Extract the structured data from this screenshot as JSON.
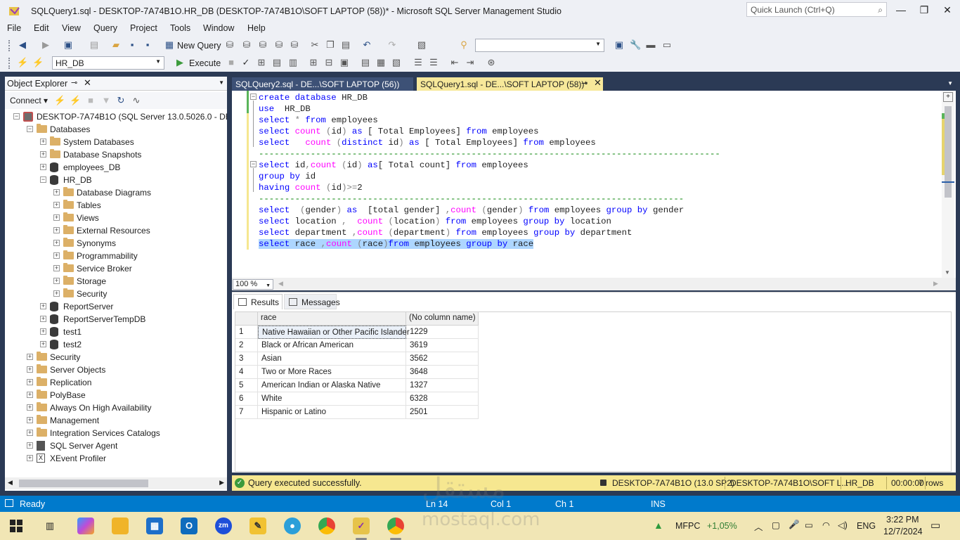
{
  "window": {
    "title": "SQLQuery1.sql - DESKTOP-7A74B1O.HR_DB (DESKTOP-7A74B1O\\SOFT LAPTOP (58))* - Microsoft SQL Server Management Studio",
    "quick_launch_placeholder": "Quick Launch (Ctrl+Q)",
    "min": "—",
    "max": "❐",
    "close": "✕"
  },
  "menu": [
    "File",
    "Edit",
    "View",
    "Query",
    "Project",
    "Tools",
    "Window",
    "Help"
  ],
  "toolbar1": {
    "new_query": "New Query"
  },
  "toolbar2": {
    "database": "HR_DB",
    "execute": "Execute"
  },
  "object_explorer": {
    "title": "Object Explorer",
    "pin": "⊸",
    "close": "✕",
    "connect": "Connect ▾",
    "tree": [
      {
        "label": "DESKTOP-7A74B1O (SQL Server 13.0.5026.0 - DESKT",
        "level": 0,
        "icon": "server",
        "exp": "−"
      },
      {
        "label": "Databases",
        "level": 1,
        "icon": "folder",
        "exp": "−"
      },
      {
        "label": "System Databases",
        "level": 2,
        "icon": "folder",
        "exp": "+"
      },
      {
        "label": "Database Snapshots",
        "level": 2,
        "icon": "folder",
        "exp": "+"
      },
      {
        "label": "employees_DB",
        "level": 2,
        "icon": "db",
        "exp": "+"
      },
      {
        "label": "HR_DB",
        "level": 2,
        "icon": "db",
        "exp": "−"
      },
      {
        "label": "Database Diagrams",
        "level": 3,
        "icon": "folder",
        "exp": "+"
      },
      {
        "label": "Tables",
        "level": 3,
        "icon": "folder",
        "exp": "+"
      },
      {
        "label": "Views",
        "level": 3,
        "icon": "folder",
        "exp": "+"
      },
      {
        "label": "External Resources",
        "level": 3,
        "icon": "folder",
        "exp": "+"
      },
      {
        "label": "Synonyms",
        "level": 3,
        "icon": "folder",
        "exp": "+"
      },
      {
        "label": "Programmability",
        "level": 3,
        "icon": "folder",
        "exp": "+"
      },
      {
        "label": "Service Broker",
        "level": 3,
        "icon": "folder",
        "exp": "+"
      },
      {
        "label": "Storage",
        "level": 3,
        "icon": "folder",
        "exp": "+"
      },
      {
        "label": "Security",
        "level": 3,
        "icon": "folder",
        "exp": "+"
      },
      {
        "label": "ReportServer",
        "level": 2,
        "icon": "db",
        "exp": "+"
      },
      {
        "label": "ReportServerTempDB",
        "level": 2,
        "icon": "db",
        "exp": "+"
      },
      {
        "label": "test1",
        "level": 2,
        "icon": "db",
        "exp": "+"
      },
      {
        "label": "test2",
        "level": 2,
        "icon": "db",
        "exp": "+"
      },
      {
        "label": "Security",
        "level": 1,
        "icon": "folder",
        "exp": "+"
      },
      {
        "label": "Server Objects",
        "level": 1,
        "icon": "folder",
        "exp": "+"
      },
      {
        "label": "Replication",
        "level": 1,
        "icon": "folder",
        "exp": "+"
      },
      {
        "label": "PolyBase",
        "level": 1,
        "icon": "folder",
        "exp": "+"
      },
      {
        "label": "Always On High Availability",
        "level": 1,
        "icon": "folder",
        "exp": "+"
      },
      {
        "label": "Management",
        "level": 1,
        "icon": "folder",
        "exp": "+"
      },
      {
        "label": "Integration Services Catalogs",
        "level": 1,
        "icon": "folder",
        "exp": "+"
      },
      {
        "label": "SQL Server Agent",
        "level": 1,
        "icon": "agent",
        "exp": "+"
      },
      {
        "label": "XEvent Profiler",
        "level": 1,
        "icon": "xe",
        "exp": "+"
      }
    ]
  },
  "tabs": {
    "inactive": "SQLQuery2.sql - DE...\\SOFT LAPTOP (56))",
    "active": "SQLQuery1.sql - DE...\\SOFT LAPTOP (58))*",
    "active_pin": "⊸",
    "active_close": "✕"
  },
  "code": [
    [
      [
        "kw",
        "create database "
      ],
      [
        "",
        "HR_DB"
      ]
    ],
    [
      [
        "kw",
        "use  "
      ],
      [
        "",
        "HR_DB"
      ]
    ],
    [
      [
        "kw",
        "select "
      ],
      [
        "gr",
        "* "
      ],
      [
        "kw",
        "from "
      ],
      [
        "",
        "employees"
      ]
    ],
    [
      [
        "kw",
        "select "
      ],
      [
        "fn",
        "count "
      ],
      [
        "gr",
        "("
      ],
      [
        "",
        "id"
      ],
      [
        "gr",
        ") "
      ],
      [
        "kw",
        "as "
      ],
      [
        "",
        "[ Total Employees] "
      ],
      [
        "kw",
        "from "
      ],
      [
        "",
        "employees"
      ]
    ],
    [
      [
        "kw",
        "select   "
      ],
      [
        "fn",
        "count "
      ],
      [
        "gr",
        "("
      ],
      [
        "kw",
        "distinct "
      ],
      [
        "",
        "id"
      ],
      [
        "gr",
        ") "
      ],
      [
        "kw",
        "as "
      ],
      [
        "",
        "[ Total Employees] "
      ],
      [
        "kw",
        "from "
      ],
      [
        "",
        "employees"
      ]
    ],
    [
      [
        "cm",
        "-----------------------------------------------------------------------------------------"
      ]
    ],
    [
      [
        "kw",
        "select "
      ],
      [
        "",
        "id"
      ],
      [
        "gr",
        ","
      ],
      [
        "fn",
        "count "
      ],
      [
        "gr",
        "("
      ],
      [
        "",
        "id"
      ],
      [
        "gr",
        ") "
      ],
      [
        "kw",
        "as"
      ],
      [
        "",
        "[ Total count] "
      ],
      [
        "kw",
        "from "
      ],
      [
        "",
        "employees"
      ]
    ],
    [
      [
        "kw",
        "group by "
      ],
      [
        "",
        "id"
      ]
    ],
    [
      [
        "kw",
        "having "
      ],
      [
        "fn",
        "count "
      ],
      [
        "gr",
        "("
      ],
      [
        "",
        "id"
      ],
      [
        "gr",
        ")>="
      ],
      [
        "",
        "2"
      ]
    ],
    [
      [
        "cm",
        "----------------------------------------------------------------------------------"
      ]
    ],
    [
      [
        "kw",
        "select  "
      ],
      [
        "gr",
        "("
      ],
      [
        "",
        "gender"
      ],
      [
        "gr",
        ") "
      ],
      [
        "kw",
        "as  "
      ],
      [
        "",
        "[total gender] "
      ],
      [
        "gr",
        ","
      ],
      [
        "fn",
        "count "
      ],
      [
        "gr",
        "("
      ],
      [
        "",
        "gender"
      ],
      [
        "gr",
        ") "
      ],
      [
        "kw",
        "from "
      ],
      [
        "",
        "employees "
      ],
      [
        "kw",
        "group by "
      ],
      [
        "",
        "gender"
      ]
    ],
    [
      [
        "kw",
        "select "
      ],
      [
        "",
        "location "
      ],
      [
        "gr",
        ",  "
      ],
      [
        "fn",
        "count "
      ],
      [
        "gr",
        "("
      ],
      [
        "",
        "location"
      ],
      [
        "gr",
        ") "
      ],
      [
        "kw",
        "from "
      ],
      [
        "",
        "employees "
      ],
      [
        "kw",
        "group by "
      ],
      [
        "",
        "location"
      ]
    ],
    [
      [
        "kw",
        "select "
      ],
      [
        "",
        "department "
      ],
      [
        "gr",
        ","
      ],
      [
        "fn",
        "count "
      ],
      [
        "gr",
        "("
      ],
      [
        "",
        "department"
      ],
      [
        "gr",
        ") "
      ],
      [
        "kw",
        "from "
      ],
      [
        "",
        "employees "
      ],
      [
        "kw",
        "group by "
      ],
      [
        "",
        "department"
      ]
    ],
    [
      [
        "kw",
        "select "
      ],
      [
        "",
        "race "
      ],
      [
        "gr",
        ","
      ],
      [
        "fn",
        "count "
      ],
      [
        "gr",
        "("
      ],
      [
        "",
        "race"
      ],
      [
        "gr",
        ")"
      ],
      [
        "kw",
        "from "
      ],
      [
        "",
        "employees "
      ],
      [
        "kw",
        "group by "
      ],
      [
        "",
        "race"
      ]
    ]
  ],
  "zoom": "100 %",
  "results": {
    "tab_results": "Results",
    "tab_messages": "Messages",
    "columns": [
      "race",
      "(No column name)"
    ],
    "rows": [
      [
        "1",
        "Native Hawaiian or Other Pacific Islander",
        "1229"
      ],
      [
        "2",
        "Black or African American",
        "3619"
      ],
      [
        "3",
        "Asian",
        "3562"
      ],
      [
        "4",
        "Two or More Races",
        "3648"
      ],
      [
        "5",
        "American Indian or Alaska Native",
        "1327"
      ],
      [
        "6",
        "White",
        "6328"
      ],
      [
        "7",
        "Hispanic or Latino",
        "2501"
      ]
    ]
  },
  "query_status": {
    "message": "Query executed successfully.",
    "server": "DESKTOP-7A74B1O (13.0 SP2)",
    "user": "DESKTOP-7A74B1O\\SOFT L...",
    "database": "HR_DB",
    "elapsed": "00:00:00",
    "rows": "7 rows"
  },
  "statusbar": {
    "ready": "Ready",
    "ln": "Ln 14",
    "col": "Col 1",
    "ch": "Ch 1",
    "ins": "INS"
  },
  "taskbar": {
    "stock_name": "MFPC",
    "stock_change": "+1,05%",
    "language": "ENG",
    "time": "3:22 PM",
    "date": "12/7/2024"
  },
  "watermark": {
    "arabic": "مستقل",
    "latin": "mostaql.com"
  },
  "colors": {
    "accent": "#007acc",
    "tab_active": "#f7e89a",
    "keyword": "#0000ff",
    "function": "#ff00ff",
    "comment": "#008000"
  }
}
